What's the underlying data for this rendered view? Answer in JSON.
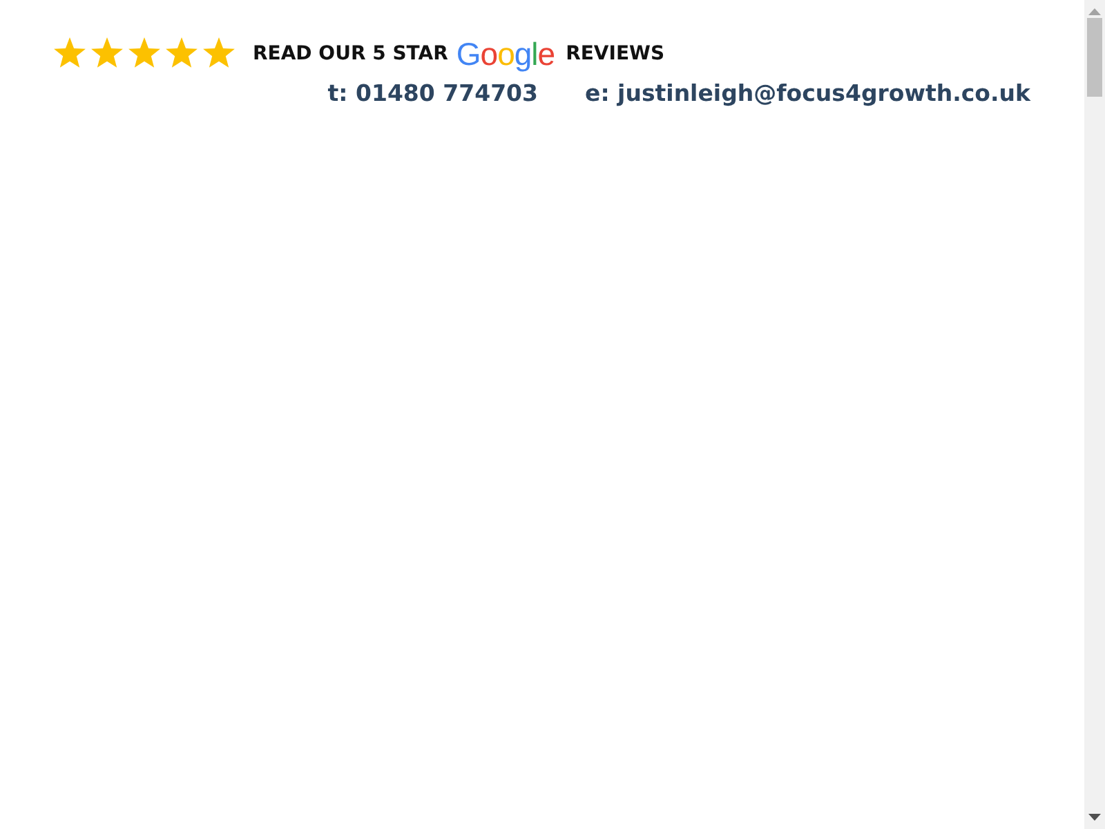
{
  "reviews": {
    "stars": 5,
    "lead": "READ OUR 5 STAR",
    "logo": "Google",
    "tail": "REVIEWS"
  },
  "contact": {
    "phone": "t: 01480 774703",
    "email": "e: justinleigh@focus4growth.co.uk"
  }
}
